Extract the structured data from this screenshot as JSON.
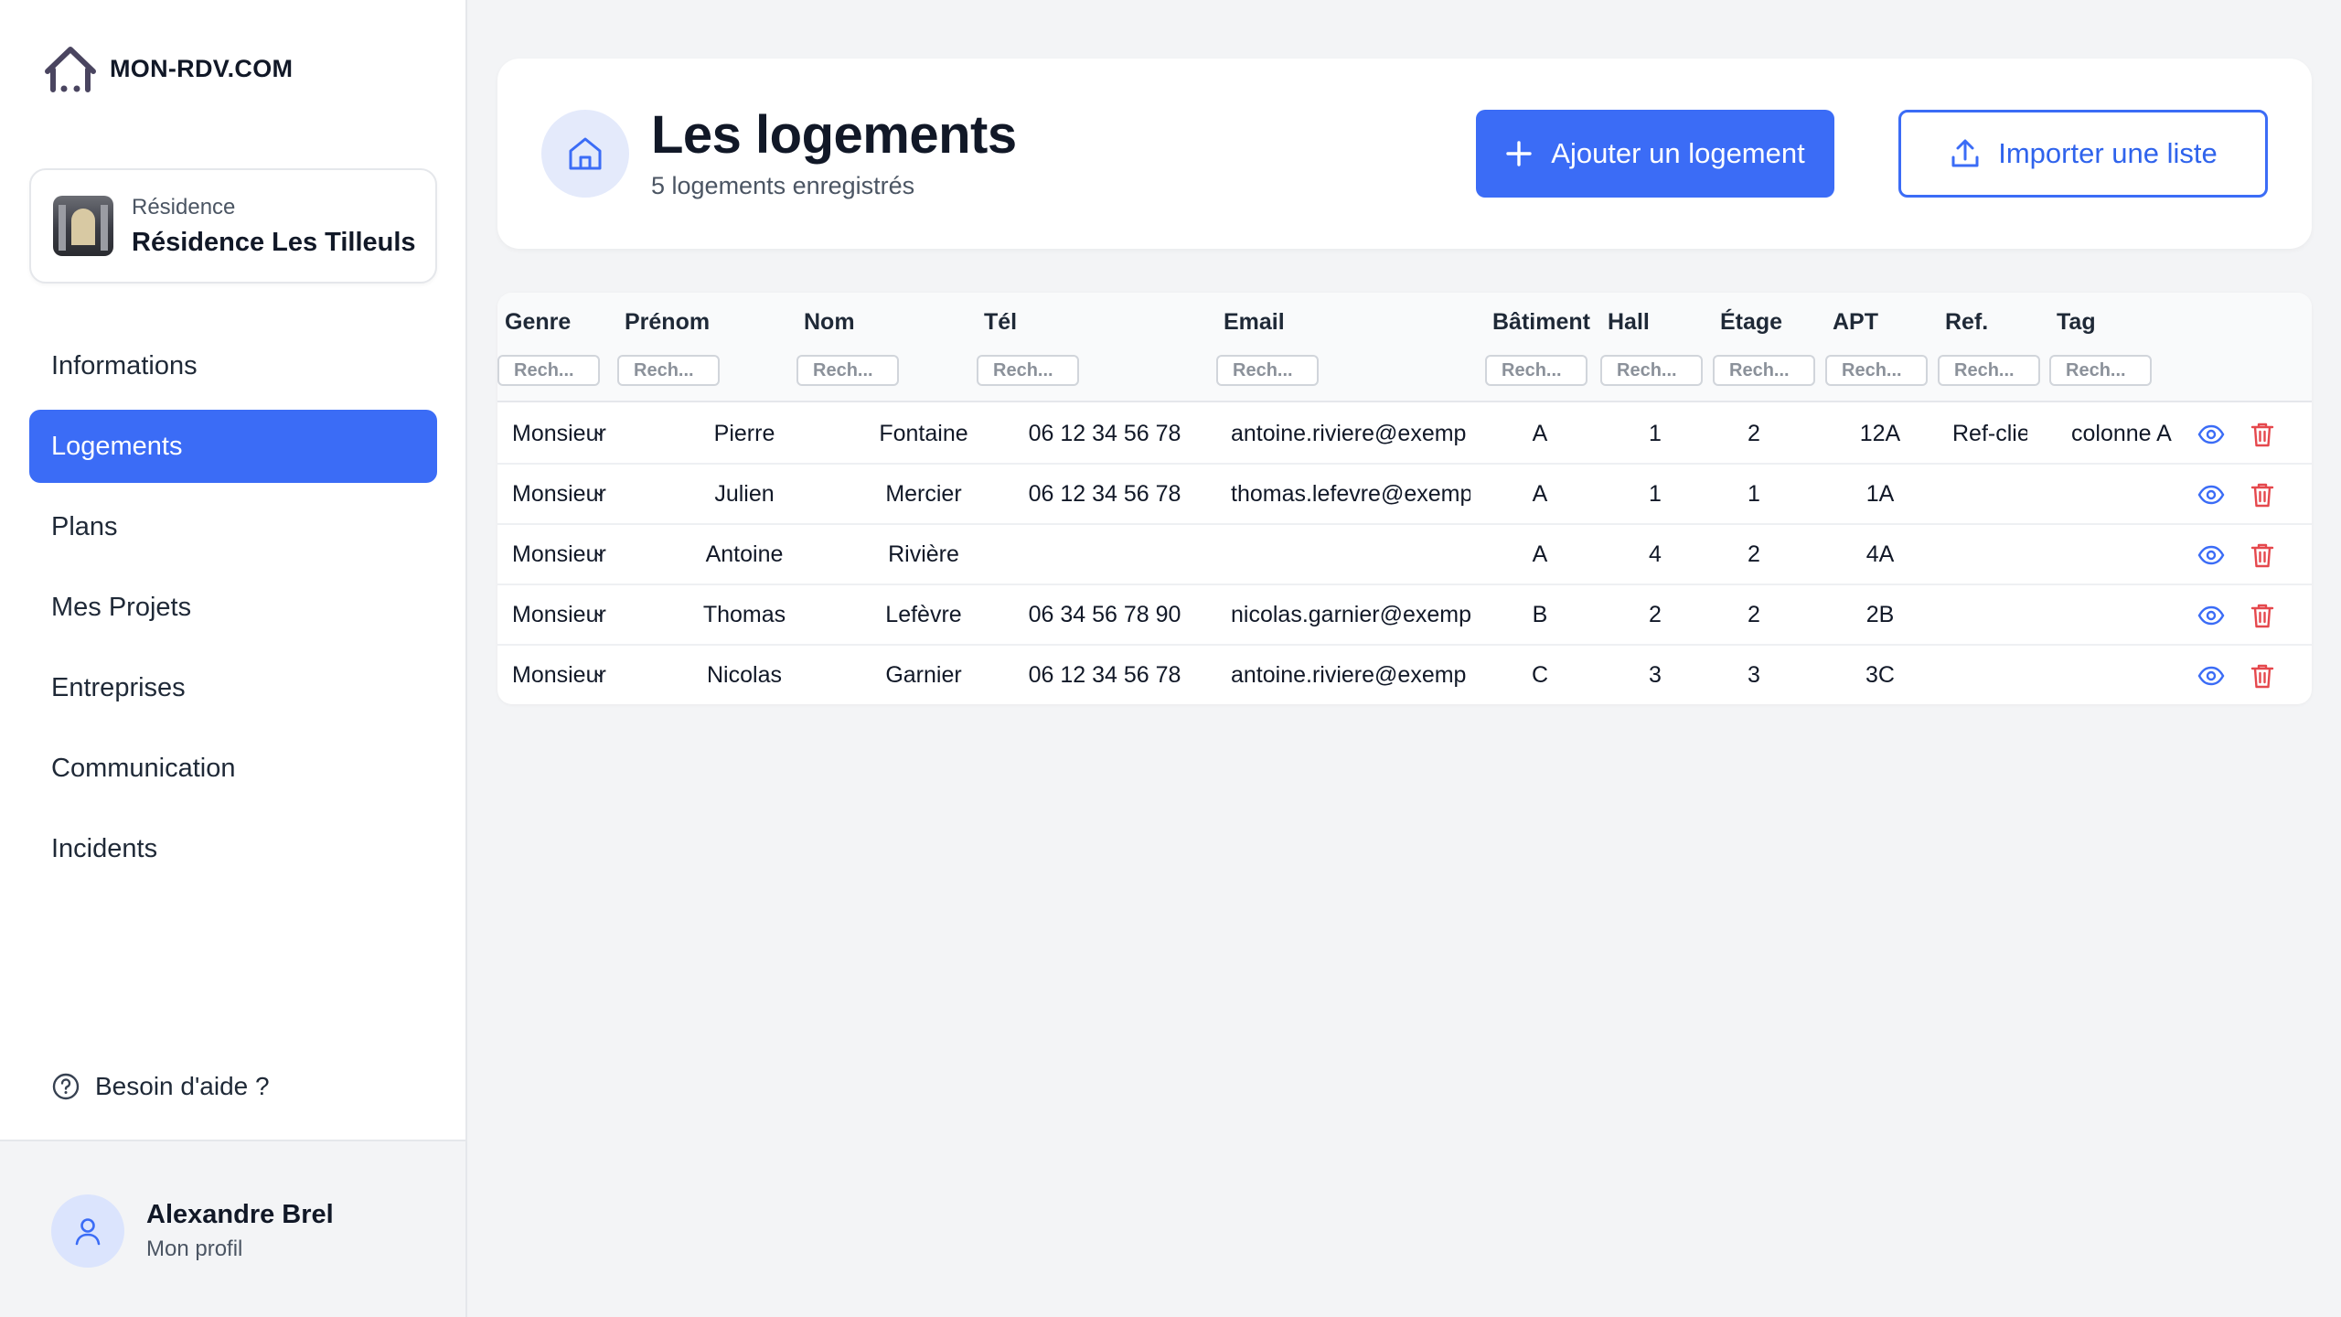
{
  "brand": {
    "name": "MON-RDV.COM"
  },
  "residence": {
    "label": "Résidence",
    "name": "Résidence Les Tilleuls"
  },
  "nav": [
    {
      "label": "Informations",
      "active": false
    },
    {
      "label": "Logements",
      "active": true
    },
    {
      "label": "Plans",
      "active": false
    },
    {
      "label": "Mes Projets",
      "active": false
    },
    {
      "label": "Entreprises",
      "active": false
    },
    {
      "label": "Communication",
      "active": false
    },
    {
      "label": "Incidents",
      "active": false
    }
  ],
  "help": {
    "label": "Besoin d'aide ?"
  },
  "profile": {
    "name": "Alexandre Brel",
    "link": "Mon profil"
  },
  "header": {
    "title": "Les logements",
    "subtitle": "5 logements enregistrés",
    "add_label": "Ajouter un logement",
    "import_label": "Importer une liste"
  },
  "table": {
    "columns": [
      "Genre",
      "Prénom",
      "Nom",
      "Tél",
      "Email",
      "Bâtiment",
      "Hall",
      "Étage",
      "APT",
      "Ref.",
      "Tag"
    ],
    "filter_placeholder": "Rech...",
    "rows": [
      {
        "genre": "Monsieur",
        "prenom": "Pierre",
        "nom": "Fontaine",
        "tel": "06 12 34 56 78",
        "email": "antoine.riviere@exemp",
        "batiment": "A",
        "hall": "1",
        "etage": "2",
        "apt": "12A",
        "ref": "Ref-clie",
        "tag": "colonne A"
      },
      {
        "genre": "Monsieur",
        "prenom": "Julien",
        "nom": "Mercier",
        "tel": "06 12 34 56 78",
        "email": "thomas.lefevre@exemp",
        "batiment": "A",
        "hall": "1",
        "etage": "1",
        "apt": "1A",
        "ref": "",
        "tag": ""
      },
      {
        "genre": "Monsieur",
        "prenom": "Antoine",
        "nom": "Rivière",
        "tel": "",
        "email": "",
        "batiment": "A",
        "hall": "4",
        "etage": "2",
        "apt": "4A",
        "ref": "",
        "tag": ""
      },
      {
        "genre": "Monsieur",
        "prenom": "Thomas",
        "nom": "Lefèvre",
        "tel": "06 34 56 78 90",
        "email": "nicolas.garnier@exemp",
        "batiment": "B",
        "hall": "2",
        "etage": "2",
        "apt": "2B",
        "ref": "",
        "tag": ""
      },
      {
        "genre": "Monsieur",
        "prenom": "Nicolas",
        "nom": "Garnier",
        "tel": "06 12 34 56 78",
        "email": "antoine.riviere@exemp",
        "batiment": "C",
        "hall": "3",
        "etage": "3",
        "apt": "3C",
        "ref": "",
        "tag": ""
      }
    ]
  },
  "colors": {
    "accent": "#3b6cf6",
    "danger": "#e5484d",
    "eye": "#3b6cf6"
  },
  "icons": {
    "brand": "house-logo-icon",
    "view": "eye-icon",
    "delete": "trash-icon",
    "add": "plus-icon",
    "import": "upload-icon",
    "help": "question-circle-icon",
    "avatar": "user-icon",
    "home": "home-icon",
    "genre": "chevron-down-icon"
  }
}
